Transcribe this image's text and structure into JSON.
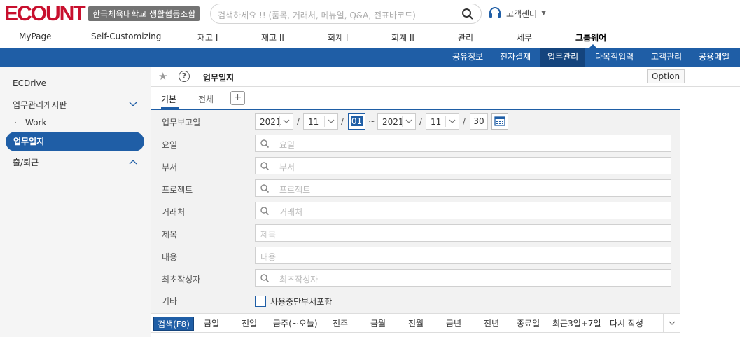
{
  "header": {
    "logo_text": "ECOUNT",
    "company_name": "한국체육대학교 생활협동조합",
    "search_placeholder": "검색하세요 !! (품목, 거래처, 메뉴얼, Q&A, 전표바코드)",
    "customer_center_label": "고객센터",
    "icons": {
      "search": "search-icon",
      "headset": "headset-icon",
      "caret": "caret-down-icon"
    }
  },
  "main_menu": [
    {
      "label": "MyPage"
    },
    {
      "label": "Self-Customizing"
    },
    {
      "label": "재고 I"
    },
    {
      "label": "재고 II"
    },
    {
      "label": "회계 I"
    },
    {
      "label": "회계 II"
    },
    {
      "label": "관리"
    },
    {
      "label": "세무"
    },
    {
      "label": "그룹웨어",
      "active": true
    }
  ],
  "sub_menu": [
    {
      "label": "공유정보"
    },
    {
      "label": "전자결재"
    },
    {
      "label": "업무관리",
      "active": true
    },
    {
      "label": "다목적입력"
    },
    {
      "label": "고객관리"
    },
    {
      "label": "공용메일"
    }
  ],
  "sidebar": {
    "items": [
      {
        "label": "ECDrive"
      },
      {
        "label": "업무관리게시판",
        "chevron": "chevron-down-icon"
      },
      {
        "label": "Work",
        "bullet": "·"
      },
      {
        "label": "업무일지",
        "active": true
      },
      {
        "label": "출/퇴근",
        "chevron": "chevron-up-icon"
      }
    ]
  },
  "page": {
    "title": "업무일지",
    "option_label": "Option",
    "icons": {
      "star": "star-icon",
      "help": "help-icon"
    }
  },
  "tabs": [
    {
      "label": "기본",
      "active": true
    },
    {
      "label": "전체"
    },
    {
      "label": "+"
    }
  ],
  "form": {
    "date": {
      "label": "업무보고일",
      "from_year": "2021",
      "from_month": "11",
      "from_day": "01",
      "separator": "~",
      "to_year": "2021",
      "to_month": "11",
      "to_day": "30",
      "slash": "/"
    },
    "fields": [
      {
        "label": "요일",
        "placeholder": "요일",
        "search_icon": true
      },
      {
        "label": "부서",
        "placeholder": "부서",
        "search_icon": true
      },
      {
        "label": "프로젝트",
        "placeholder": "프로젝트",
        "search_icon": true
      },
      {
        "label": "거래처",
        "placeholder": "거래처",
        "search_icon": true
      },
      {
        "label": "제목",
        "placeholder": "제목",
        "search_icon": false
      },
      {
        "label": "내용",
        "placeholder": "내용",
        "search_icon": false
      },
      {
        "label": "최초작성자",
        "placeholder": "최초작성자",
        "search_icon": true
      }
    ],
    "other": {
      "label": "기타",
      "checkbox_label": "사용중단부서포함",
      "checked": false
    }
  },
  "quick_bar": [
    {
      "label": "검색(F8)",
      "primary": true
    },
    {
      "label": "금일"
    },
    {
      "label": "전일"
    },
    {
      "label": "금주(~오늘)"
    },
    {
      "label": "전주"
    },
    {
      "label": "금월"
    },
    {
      "label": "전월"
    },
    {
      "label": "금년"
    },
    {
      "label": "전년"
    },
    {
      "label": "종료일"
    },
    {
      "label": "최근3일+7일"
    },
    {
      "label": "다시 작성"
    }
  ],
  "colors": {
    "brand_blue": "#1f5ea6",
    "brand_blue_dark": "#14447d",
    "logo_red": "#c8102e"
  }
}
